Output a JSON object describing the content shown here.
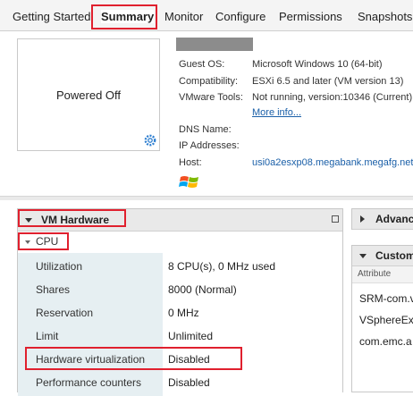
{
  "tabs": [
    {
      "label": "Getting Started"
    },
    {
      "label": "Summary",
      "active": true
    },
    {
      "label": "Monitor"
    },
    {
      "label": "Configure"
    },
    {
      "label": "Permissions"
    },
    {
      "label": "Snapshots"
    }
  ],
  "vm": {
    "power_state": "Powered Off",
    "guest_os_label": "Guest OS:",
    "guest_os_value": "Microsoft Windows 10 (64-bit)",
    "compat_label": "Compatibility:",
    "compat_value": "ESXi 6.5 and later (VM version 13)",
    "tools_label": "VMware Tools:",
    "tools_value": "Not running, version:10346 (Current)",
    "more_info": "More info...",
    "dns_label": "DNS Name:",
    "ip_label": "IP Addresses:",
    "host_label": "Host:",
    "host_value": "usi0a2esxp08.megabank.megafg.net"
  },
  "hardware": {
    "title": "VM Hardware",
    "cpu_label": "CPU",
    "rows": [
      {
        "label": "Utilization",
        "value": "8 CPU(s), 0 MHz used"
      },
      {
        "label": "Shares",
        "value": "8000 (Normal)"
      },
      {
        "label": "Reservation",
        "value": "0 MHz"
      },
      {
        "label": "Limit",
        "value": "Unlimited"
      },
      {
        "label": "Hardware virtualization",
        "value": "Disabled"
      },
      {
        "label": "Performance counters",
        "value": "Disabled"
      }
    ]
  },
  "right": {
    "advanced_title": "Advanc",
    "custom_title": "Custom",
    "attr_header": "Attribute",
    "attrs": [
      "SRM-com.v",
      "VSphereEx",
      "com.emc.a"
    ]
  },
  "colors": {
    "highlight": "#e0202e",
    "link": "#1a5fa8",
    "cpu_col": "#e6eff2"
  }
}
